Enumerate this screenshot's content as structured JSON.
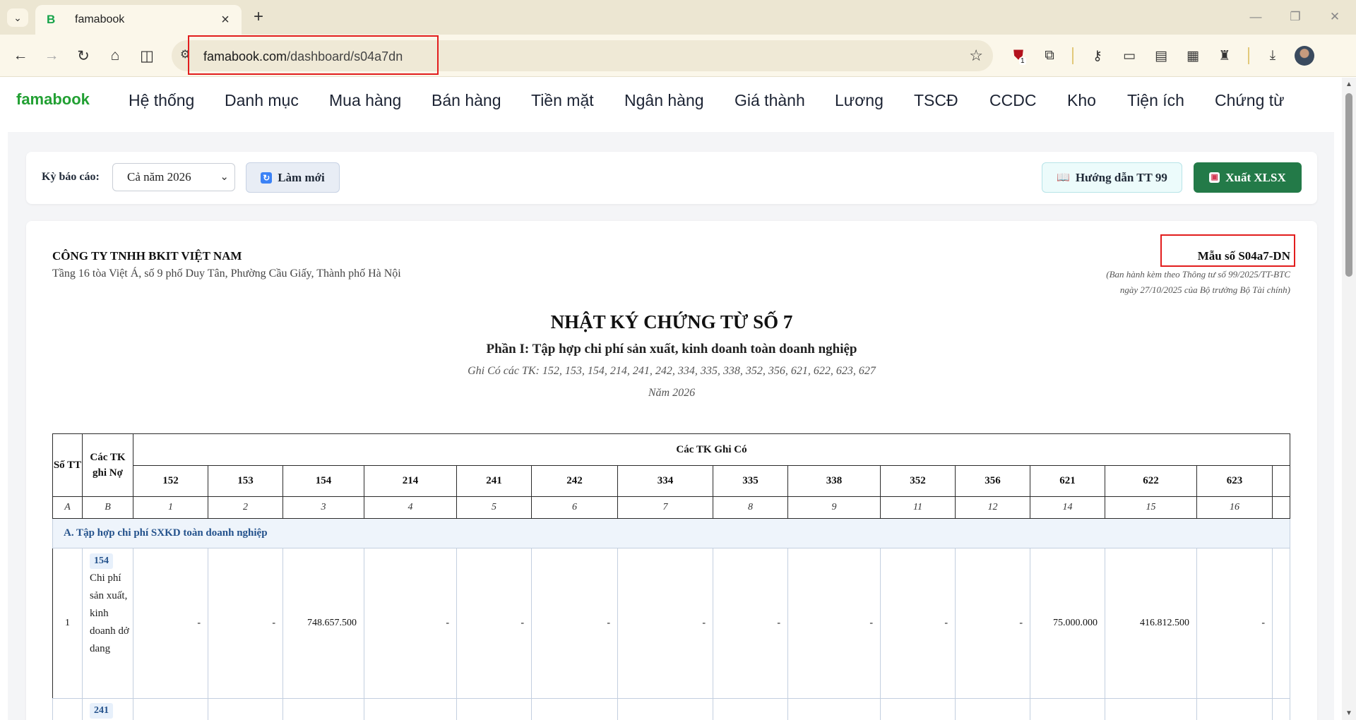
{
  "browser": {
    "tab_title": "famabook",
    "tab_favicon": "B",
    "url_domain": "famabook.com",
    "url_path": "/dashboard/s04a7dn",
    "extension_badge": "1"
  },
  "app": {
    "brand": "famabook",
    "menu": [
      "Hệ thống",
      "Danh mục",
      "Mua hàng",
      "Bán hàng",
      "Tiền mặt",
      "Ngân hàng",
      "Giá thành",
      "Lương",
      "TSCĐ",
      "CCDC",
      "Kho",
      "Tiện ích",
      "Chứng từ"
    ]
  },
  "filter": {
    "period_label": "Kỳ báo cáo:",
    "period_value": "Cả năm 2026",
    "refresh_label": "Làm mới",
    "guide_label": "Hướng dẫn TT 99",
    "export_label": "Xuất XLSX"
  },
  "report": {
    "company": "CÔNG TY TNHH BKIT VIỆT NAM",
    "address": "Tầng 16 tòa Việt Á, số 9 phố Duy Tân, Phường Cầu Giấy, Thành phố Hà Nội",
    "form_no": "Mẫu số S04a7-DN",
    "issued_line1": "(Ban hành kèm theo Thông tư số 99/2025/TT-BTC",
    "issued_line2": "ngày 27/10/2025 của Bộ trưởng Bộ Tài chính)",
    "title": "NHẬT KÝ CHỨNG TỪ SỐ 7",
    "subtitle": "Phần I: Tập hợp chi phí sản xuất, kinh doanh toàn doanh nghiệp",
    "note": "Ghi Có các TK: 152, 153, 154, 214, 241, 242, 334, 335, 338, 352, 356, 621, 622, 623, 627",
    "year": "Năm 2026"
  },
  "table": {
    "col_stt": "Số TT",
    "col_debit": "Các TK ghi Nợ",
    "group_header": "Các TK Ghi Có",
    "credit_accounts": [
      "152",
      "153",
      "154",
      "214",
      "241",
      "242",
      "334",
      "335",
      "338",
      "352",
      "356",
      "621",
      "622",
      "623"
    ],
    "index_labels": [
      "A",
      "B",
      "1",
      "2",
      "3",
      "4",
      "5",
      "6",
      "7",
      "8",
      "9",
      "11",
      "12",
      "14",
      "15",
      "16"
    ],
    "section_a": "A. Tập hợp chi phí SXKD toàn doanh nghiệp",
    "rows": [
      {
        "stt": "1",
        "account": "154",
        "account_name": "Chi phí sản xuất, kinh doanh dở dang",
        "values": [
          "-",
          "-",
          "748.657.500",
          "-",
          "-",
          "-",
          "-",
          "-",
          "-",
          "-",
          "-",
          "75.000.000",
          "416.812.500",
          "-"
        ]
      },
      {
        "stt": "",
        "account": "241",
        "account_name": "",
        "values": [
          "",
          "",
          "",
          "",
          "",
          "",
          "",
          "",
          "",
          "",
          "",
          "",
          "",
          ""
        ]
      }
    ]
  }
}
